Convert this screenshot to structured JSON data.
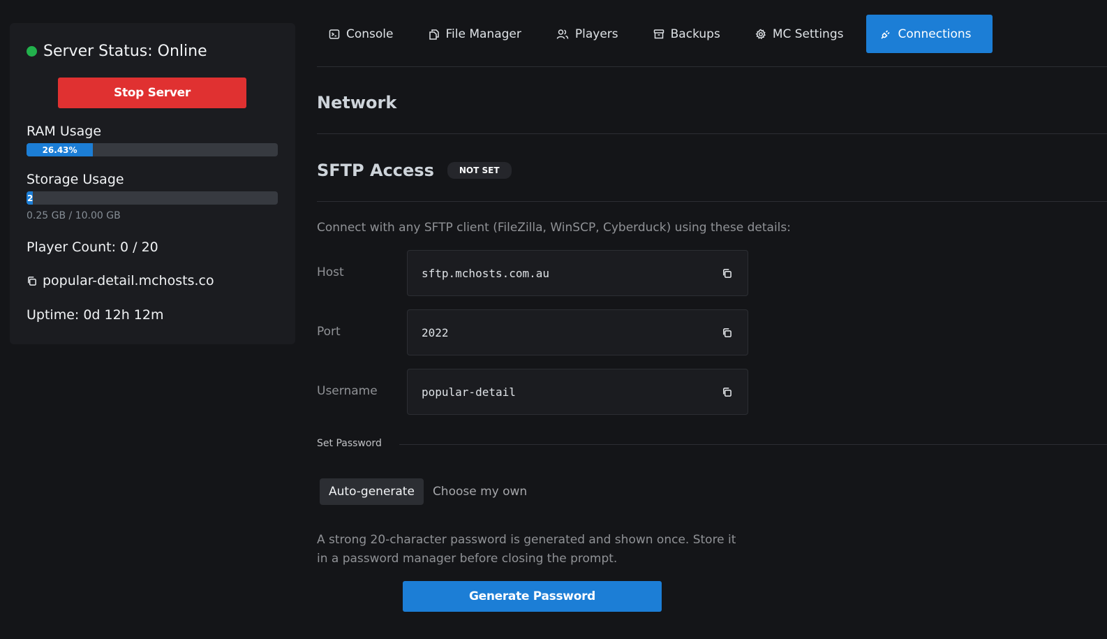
{
  "sidebar": {
    "status_text": "Server Status: Online",
    "status_color": "#22b14c",
    "stop_button": "Stop Server",
    "ram": {
      "label": "RAM Usage",
      "percent_text": "26.43%",
      "fraction": 0.2643
    },
    "storage": {
      "label": "Storage Usage",
      "bar_text": "2",
      "fraction": 0.025,
      "detail": "0.25 GB / 10.00 GB"
    },
    "player_count": "Player Count: 0 / 20",
    "address": "popular-detail.mchosts.co",
    "uptime": "Uptime: 0d 12h 12m"
  },
  "tabs": [
    {
      "label": "Console",
      "icon": "terminal-icon"
    },
    {
      "label": "File Manager",
      "icon": "files-icon"
    },
    {
      "label": "Players",
      "icon": "users-icon"
    },
    {
      "label": "Backups",
      "icon": "archive-icon"
    },
    {
      "label": "MC Settings",
      "icon": "gear-icon"
    },
    {
      "label": "Connections",
      "icon": "plug-icon",
      "active": true
    }
  ],
  "main": {
    "network_heading": "Network",
    "sftp_heading": "SFTP Access",
    "sftp_badge": "NOT SET",
    "connect_text": "Connect with any SFTP client (FileZilla, WinSCP, Cyberduck) using these details:",
    "fields": [
      {
        "label": "Host",
        "value": "sftp.mchosts.com.au"
      },
      {
        "label": "Port",
        "value": "2022"
      },
      {
        "label": "Username",
        "value": "popular-detail"
      }
    ],
    "set_password_label": "Set Password",
    "mode_options": [
      "Auto-generate",
      "Choose my own"
    ],
    "help_text": "A strong 20-character password is generated and shown once. Store it in a password manager before closing the prompt.",
    "generate_button": "Generate Password"
  },
  "colors": {
    "accent": "#1c7ed6",
    "danger": "#e03131",
    "background": "#141518",
    "panel": "#1b1c20"
  }
}
